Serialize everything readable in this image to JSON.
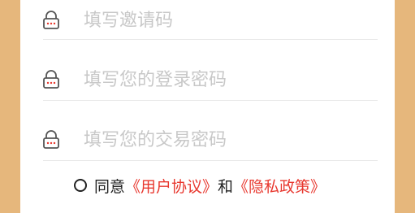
{
  "form": {
    "fields": [
      {
        "icon": "lock-icon",
        "placeholder": "填写邀请码",
        "value": ""
      },
      {
        "icon": "lock-icon",
        "placeholder": "填写您的登录密码",
        "value": ""
      },
      {
        "icon": "lock-icon",
        "placeholder": "填写您的交易密码",
        "value": ""
      }
    ]
  },
  "agreement": {
    "checked": false,
    "prefix": "同意",
    "user_agreement": "《用户协议》",
    "connector": "和",
    "privacy_policy": "《隐私政策》"
  },
  "colors": {
    "background": "#e6b77c",
    "card": "#ffffff",
    "icon": "#e8382f",
    "link": "#e8382f",
    "placeholder": "#c8c8c8",
    "divider": "#e8e8e8"
  }
}
